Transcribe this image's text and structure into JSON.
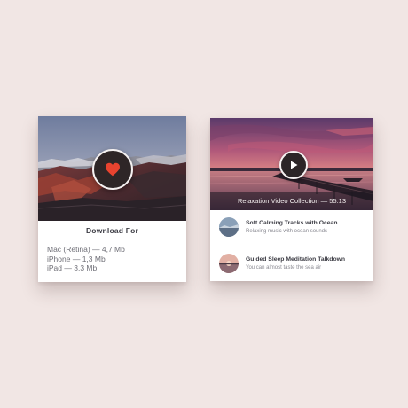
{
  "download_card": {
    "title": "Download For",
    "items": [
      "Mac (Retina) — 4,7 Mb",
      "iPhone — 1,3 Mb",
      "iPad — 3,3 Mb"
    ],
    "icon": "heart-icon",
    "accent_color": "#e8432f"
  },
  "media_card": {
    "video_caption": "Relaxation Video Collection — 55:13",
    "play_icon": "play-icon",
    "tracks": [
      {
        "title": "Soft Calming Tracks with Ocean",
        "subtitle": "Relaxing music with ocean sounds"
      },
      {
        "title": "Guided Sleep Meditation Talkdown",
        "subtitle": "You can almost taste the sea air"
      }
    ]
  },
  "colors": {
    "background": "#f1e6e4",
    "card": "#ffffff",
    "button_dark": "#2e2627"
  }
}
